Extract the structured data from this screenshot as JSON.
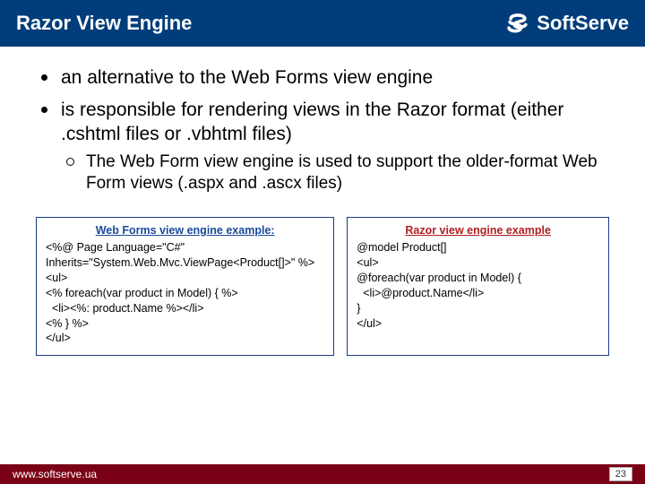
{
  "header": {
    "title": "Razor View Engine",
    "brand": "SoftServe"
  },
  "bullets": [
    {
      "text": "an alternative to the Web Forms view engine",
      "sub": []
    },
    {
      "text": "is responsible for rendering views in the Razor format (either .cshtml files or .vbhtml files)",
      "sub": [
        "The Web Form view engine is used to support the older-format Web Form views (.aspx and .ascx files)"
      ]
    }
  ],
  "codeLeft": {
    "title": "Web Forms view engine example:",
    "body": "<%@ Page Language=\"C#\" Inherits=\"System.Web.Mvc.ViewPage<Product[]>\" %>\n<ul>\n<% foreach(var product in Model) { %>\n  <li><%: product.Name %></li>\n<% } %>\n</ul>"
  },
  "codeRight": {
    "title": "Razor view engine example",
    "body": "@model Product[]\n<ul>\n@foreach(var product in Model) {\n  <li>@product.Name</li>\n}\n</ul>"
  },
  "footer": {
    "url": "www.softserve.ua",
    "page": "23"
  }
}
